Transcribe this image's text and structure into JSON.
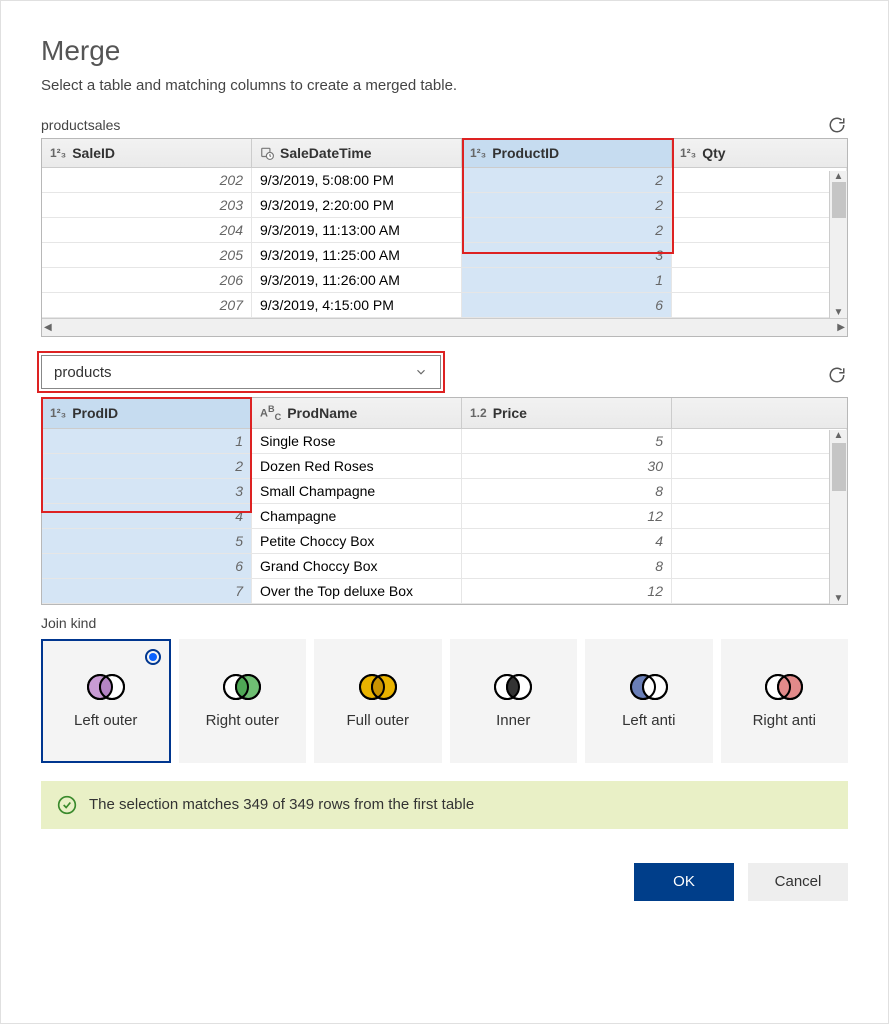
{
  "title": "Merge",
  "subtitle": "Select a table and matching columns to create a merged table.",
  "table1": {
    "name": "productsales",
    "columns": [
      "SaleID",
      "SaleDateTime",
      "ProductID",
      "Qty"
    ],
    "rows": [
      {
        "SaleID": "202",
        "SaleDateTime": "9/3/2019, 5:08:00 PM",
        "ProductID": "2",
        "Qty": ""
      },
      {
        "SaleID": "203",
        "SaleDateTime": "9/3/2019, 2:20:00 PM",
        "ProductID": "2",
        "Qty": ""
      },
      {
        "SaleID": "204",
        "SaleDateTime": "9/3/2019, 11:13:00 AM",
        "ProductID": "2",
        "Qty": ""
      },
      {
        "SaleID": "205",
        "SaleDateTime": "9/3/2019, 11:25:00 AM",
        "ProductID": "3",
        "Qty": ""
      },
      {
        "SaleID": "206",
        "SaleDateTime": "9/3/2019, 11:26:00 AM",
        "ProductID": "1",
        "Qty": ""
      },
      {
        "SaleID": "207",
        "SaleDateTime": "9/3/2019, 4:15:00 PM",
        "ProductID": "6",
        "Qty": ""
      }
    ]
  },
  "dropdown_value": "products",
  "table2": {
    "columns": [
      "ProdID",
      "ProdName",
      "Price"
    ],
    "rows": [
      {
        "ProdID": "1",
        "ProdName": "Single Rose",
        "Price": "5"
      },
      {
        "ProdID": "2",
        "ProdName": "Dozen Red Roses",
        "Price": "30"
      },
      {
        "ProdID": "3",
        "ProdName": "Small Champagne",
        "Price": "8"
      },
      {
        "ProdID": "4",
        "ProdName": "Champagne",
        "Price": "12"
      },
      {
        "ProdID": "5",
        "ProdName": "Petite Choccy Box",
        "Price": "4"
      },
      {
        "ProdID": "6",
        "ProdName": "Grand Choccy Box",
        "Price": "8"
      },
      {
        "ProdID": "7",
        "ProdName": "Over the Top deluxe Box",
        "Price": "12"
      }
    ]
  },
  "join_label": "Join kind",
  "joins": [
    "Left outer",
    "Right outer",
    "Full outer",
    "Inner",
    "Left anti",
    "Right anti"
  ],
  "status_text": "The selection matches 349 of 349 rows from the first table",
  "buttons": {
    "ok": "OK",
    "cancel": "Cancel"
  }
}
